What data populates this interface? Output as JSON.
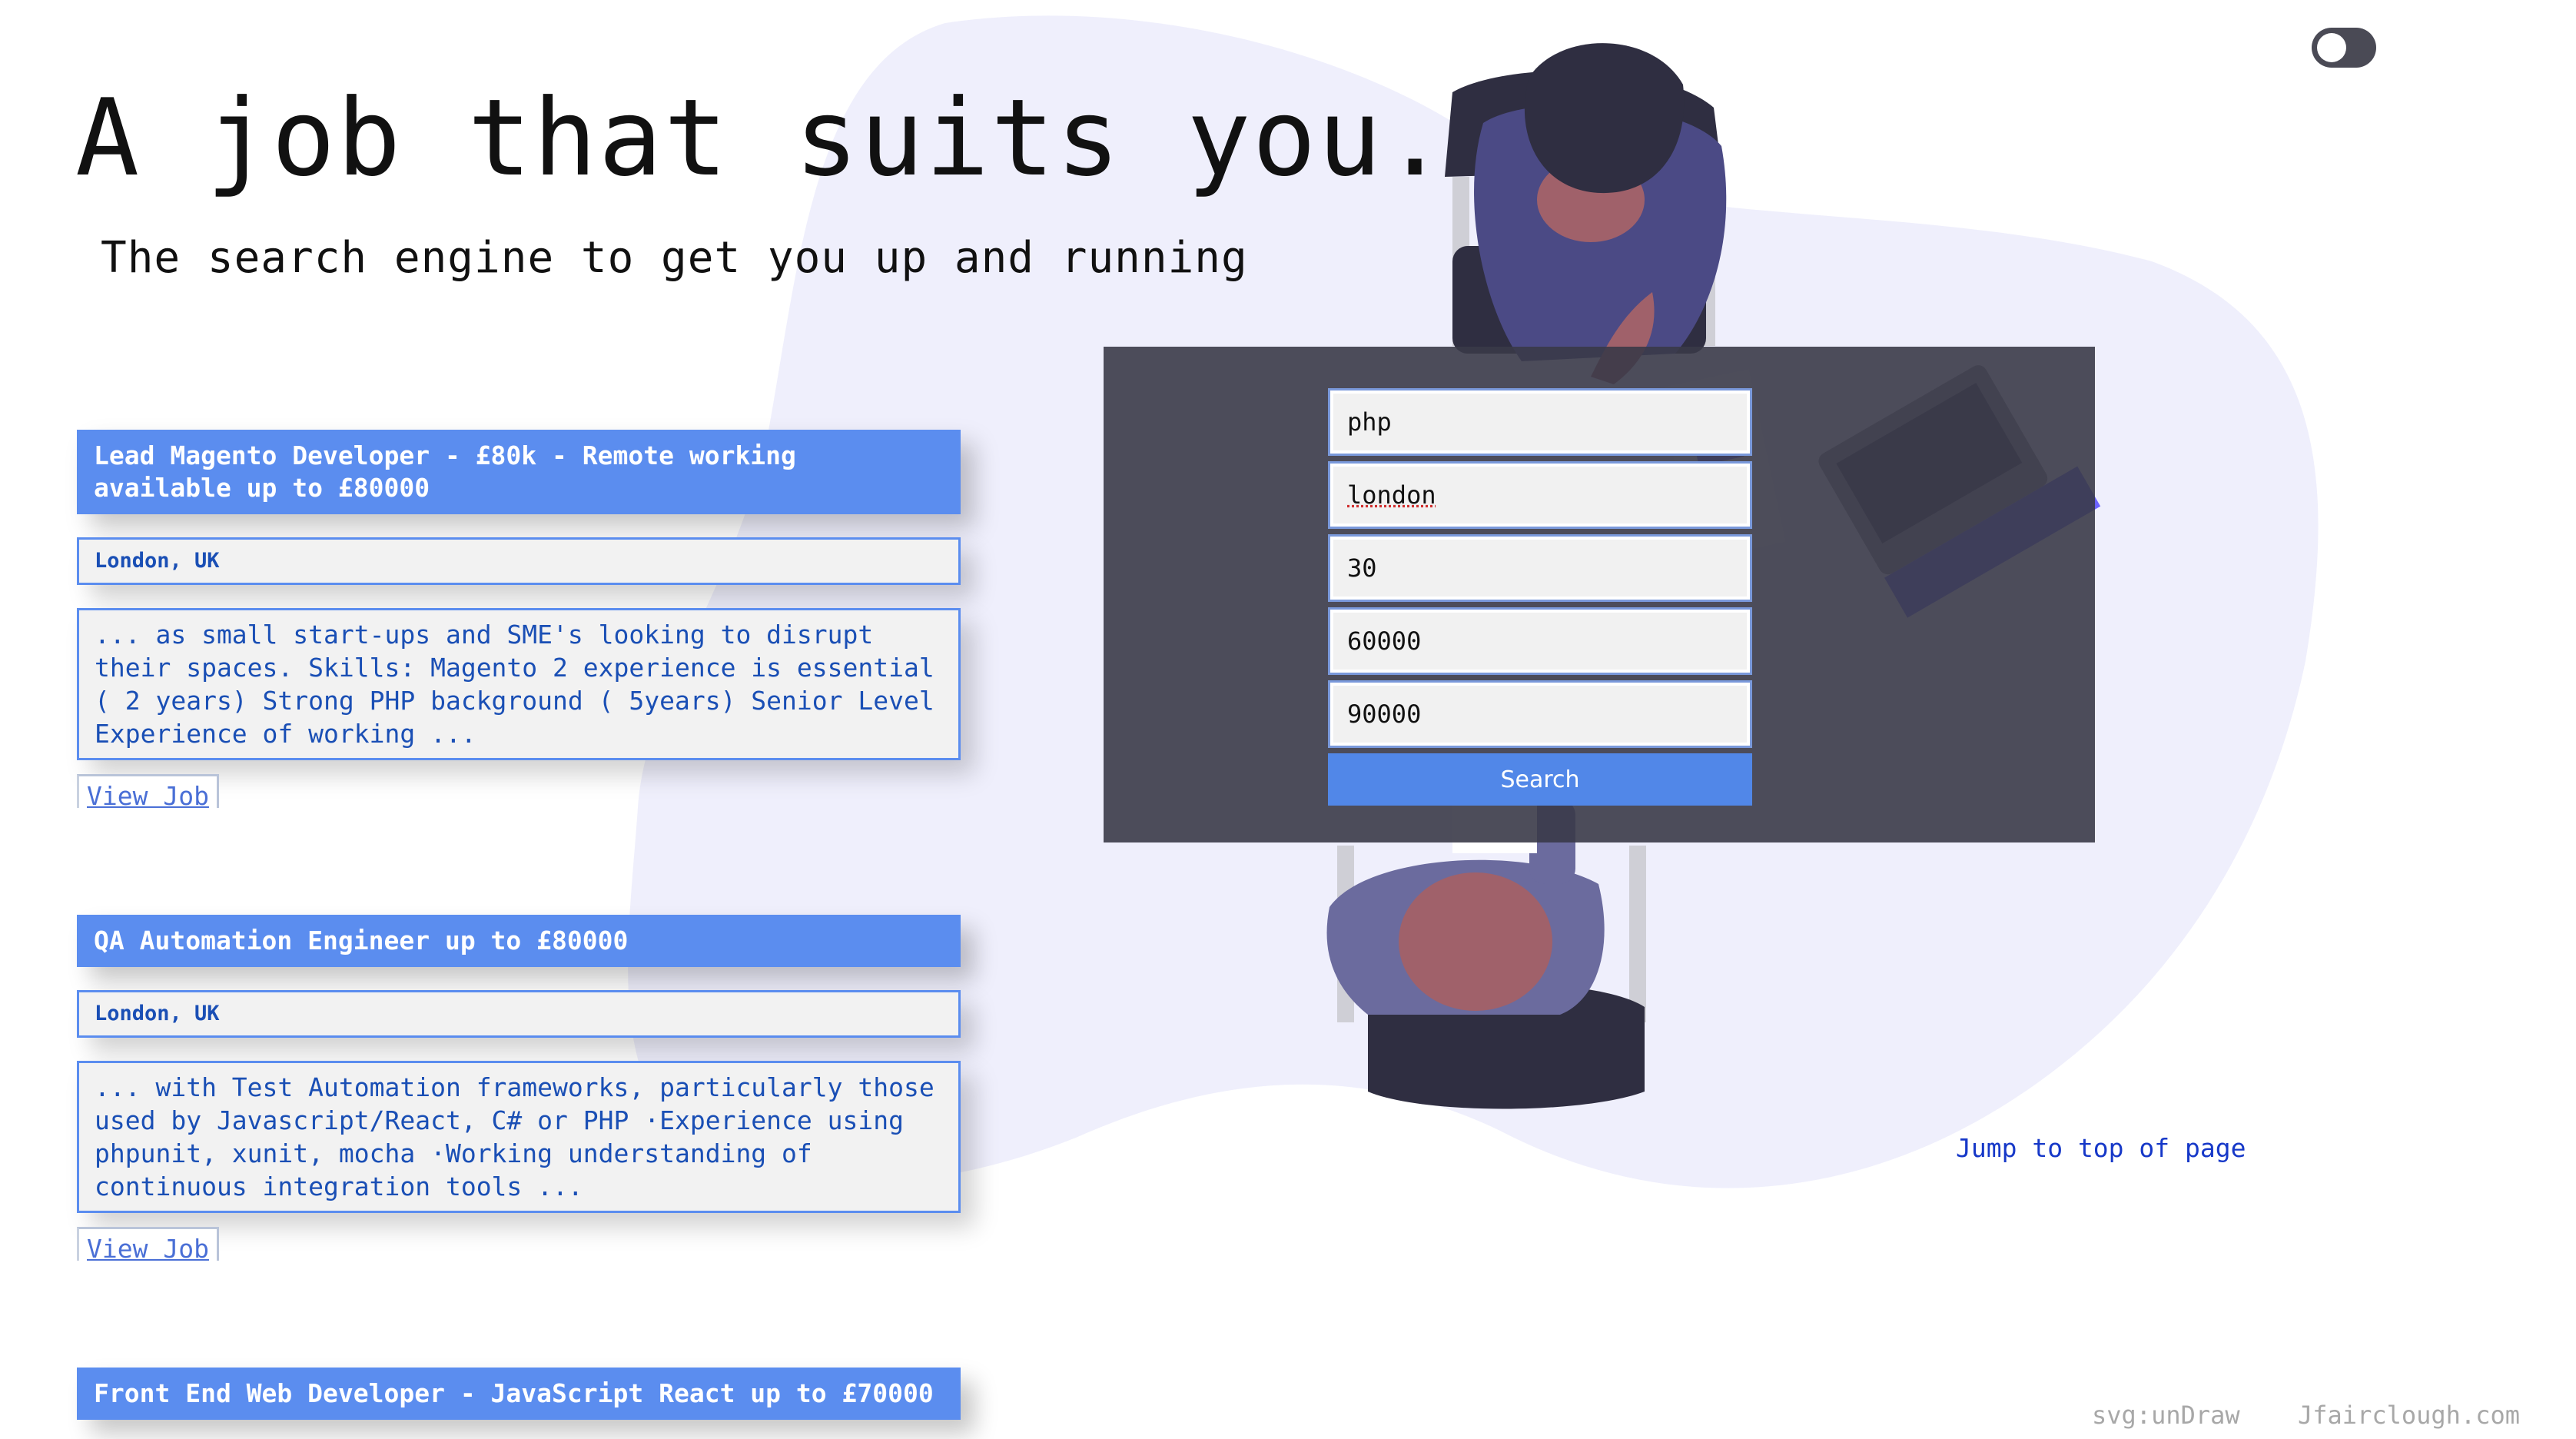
{
  "header": {
    "title": "A job that suits you.",
    "subtitle": "The search engine to get you up and running",
    "theme_toggle": "toggle-switch"
  },
  "jobs": [
    {
      "title": "Lead Magento Developer - £80k - Remote working available up to £80000",
      "location": "London, UK",
      "description": "... as small start-ups and SME's looking to disrupt their spaces. Skills: Magento 2 experience is essential ( 2 years) Strong PHP background ( 5years) Senior Level Experience of working ...",
      "link_label": "View Job"
    },
    {
      "title": "QA Automation Engineer up to £80000",
      "location": "London, UK",
      "description": "... with Test Automation frameworks, particularly those used by Javascript/React, C# or PHP ·Experience using phpunit, xunit, mocha ·Working understanding of continuous integration tools ...",
      "link_label": "View Job"
    },
    {
      "title": "Front End Web Developer - JavaScript React up to £70000"
    }
  ],
  "search": {
    "keyword": "php",
    "location": "london",
    "distance": "30",
    "min_salary": "60000",
    "max_salary": "90000",
    "button_label": "Search"
  },
  "footer": {
    "jump_label": "Jump to top of page",
    "credit_svg": "svg:unDraw",
    "credit_site": "Jfairclough.com"
  },
  "colors": {
    "accent": "#5b8def",
    "blob": "#efeffc",
    "panel": "#3a3a48",
    "link": "#1638c8"
  }
}
